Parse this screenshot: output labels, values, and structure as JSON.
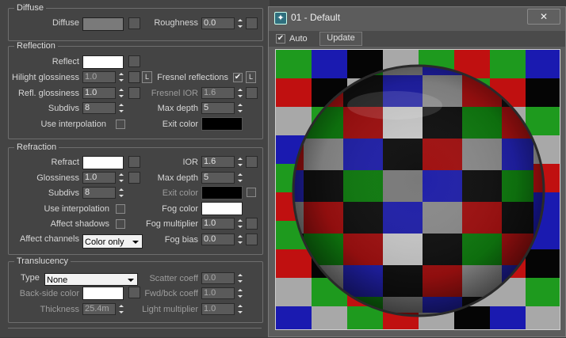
{
  "diffuse": {
    "title": "Diffuse",
    "diffuse_label": "Diffuse",
    "diffuse_color": "#7a7a7a",
    "roughness_label": "Roughness",
    "roughness_value": "0.0"
  },
  "reflection": {
    "title": "Reflection",
    "reflect_label": "Reflect",
    "reflect_color": "#ffffff",
    "hilight_glossiness_label": "Hilight glossiness",
    "hilight_glossiness_value": "1.0",
    "hilight_lock": "L",
    "fresnel_label": "Fresnel reflections",
    "fresnel_checked": "✔",
    "fresnel_lock": "L",
    "refl_glossiness_label": "Refl. glossiness",
    "refl_glossiness_value": "1.0",
    "fresnel_ior_label": "Fresnel IOR",
    "fresnel_ior_value": "1.6",
    "subdivs_label": "Subdivs",
    "subdivs_value": "8",
    "max_depth_label": "Max depth",
    "max_depth_value": "5",
    "use_interpolation_label": "Use interpolation",
    "exit_color_label": "Exit color",
    "exit_color": "#000000"
  },
  "refraction": {
    "title": "Refraction",
    "refract_label": "Refract",
    "refract_color": "#ffffff",
    "ior_label": "IOR",
    "ior_value": "1.6",
    "glossiness_label": "Glossiness",
    "glossiness_value": "1.0",
    "max_depth_label": "Max depth",
    "max_depth_value": "5",
    "subdivs_label": "Subdivs",
    "subdivs_value": "8",
    "exit_color_label": "Exit color",
    "exit_color": "#000000",
    "use_interpolation_label": "Use interpolation",
    "fog_color_label": "Fog color",
    "fog_color": "#ffffff",
    "affect_shadows_label": "Affect shadows",
    "fog_multiplier_label": "Fog multiplier",
    "fog_multiplier_value": "1.0",
    "affect_channels_label": "Affect channels",
    "affect_channels_value": "Color only",
    "fog_bias_label": "Fog bias",
    "fog_bias_value": "0.0"
  },
  "translucency": {
    "title": "Translucency",
    "type_label": "Type",
    "type_value": "None",
    "scatter_coeff_label": "Scatter coeff",
    "scatter_coeff_value": "0.0",
    "back_side_color_label": "Back-side color",
    "back_side_color": "#ffffff",
    "fwd_bck_coeff_label": "Fwd/bck coeff",
    "fwd_bck_coeff_value": "1.0",
    "thickness_label": "Thickness",
    "thickness_value": "25.4m",
    "light_multiplier_label": "Light multiplier",
    "light_multiplier_value": "1.0"
  },
  "preview_window": {
    "title": "01 - Default",
    "close_glyph": "✕",
    "auto_label": "Auto",
    "auto_checked": "✔",
    "update_label": "Update"
  }
}
